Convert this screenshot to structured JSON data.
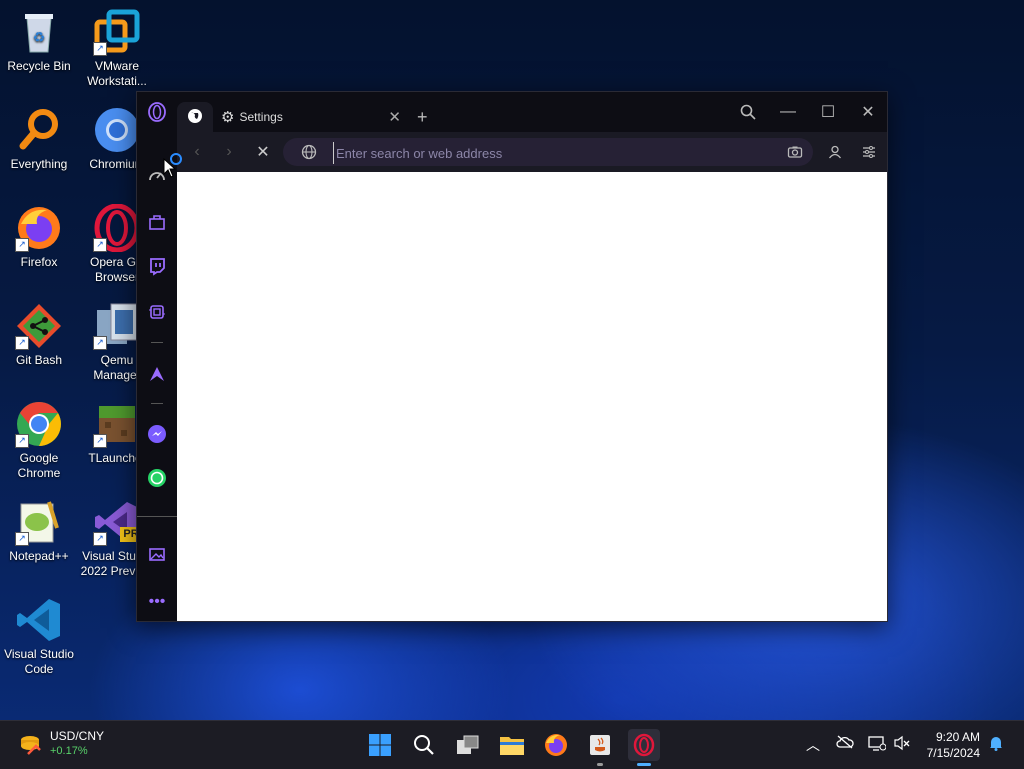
{
  "desktop": {
    "icons": [
      {
        "label": "Recycle Bin"
      },
      {
        "label": "VMware Workstati..."
      },
      {
        "label": "Everything"
      },
      {
        "label": "Chromium"
      },
      {
        "label": "Firefox"
      },
      {
        "label": "Opera GX Browser"
      },
      {
        "label": "Git Bash"
      },
      {
        "label": "Qemu Manager"
      },
      {
        "label": "Google Chrome"
      },
      {
        "label": "TLauncher"
      },
      {
        "label": "Notepad++"
      },
      {
        "label": "Visual Studio 2022 Preview"
      },
      {
        "label": "Visual Studio Code"
      }
    ],
    "badge_pre": "PRE"
  },
  "browser": {
    "tabs": [
      {
        "label": "Settings",
        "icon": "gear-icon"
      }
    ],
    "new_tab_symbol": "+",
    "address_placeholder": "Enter search or web address",
    "accent": "#9a6cff"
  },
  "taskbar": {
    "ticker_name": "USD/CNY",
    "ticker_change": "+0.17%",
    "time": "9:20 AM",
    "date": "7/15/2024"
  }
}
